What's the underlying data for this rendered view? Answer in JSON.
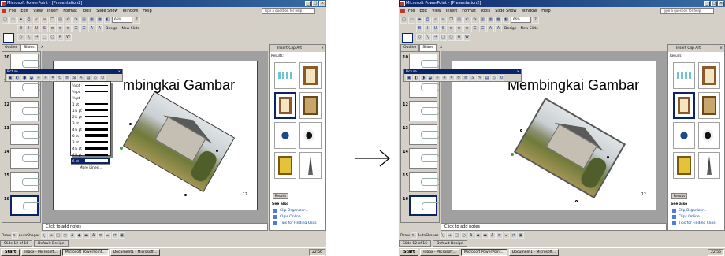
{
  "app": {
    "title": "Microsoft PowerPoint - [Presentation2]",
    "menus": [
      "File",
      "Edit",
      "View",
      "Insert",
      "Format",
      "Tools",
      "Slide Show",
      "Window",
      "Help"
    ],
    "help_placeholder": "Type a question for help",
    "zoom": "66%",
    "toolbar_design": "Design",
    "toolbar_new_slide": "New Slide"
  },
  "pane_tabs": {
    "outline": "Outline",
    "slides": "Slides"
  },
  "slide": {
    "title_left": "mbingkai Gambar",
    "title_right": "Membingkai Gambar",
    "page_number": "12"
  },
  "thumb_numbers": [
    "10",
    "11",
    "12",
    "13",
    "14",
    "15",
    "16"
  ],
  "picture_toolbar": {
    "title": "Picture"
  },
  "line_style_menu": {
    "items": [
      "¼ pt",
      "½ pt",
      "¾ pt",
      "1 pt",
      "1½ pt",
      "2¼ pt",
      "3 pt",
      "4½ pt",
      "6 pt",
      "3 pt",
      "4½ pt",
      "4½ pt",
      "6 pt"
    ],
    "weights": [
      0.5,
      0.8,
      1,
      1.3,
      1.6,
      2,
      2.5,
      3,
      3.5,
      2.5,
      3,
      3,
      3.5
    ],
    "highlighted_index": 12,
    "more": "More Lines..."
  },
  "notes": {
    "placeholder": "Click to add notes"
  },
  "task_pane": {
    "title": "Insert Clip Art",
    "results_label": "Results:",
    "search_button": "Results",
    "see_also": "See also",
    "links": [
      "Clip Organizer...",
      "Clips Online",
      "Tips for Finding Clips"
    ]
  },
  "draw_toolbar": {
    "draw_label": "Draw",
    "autoshapes_label": "AutoShapes"
  },
  "status": {
    "slide_of": "Slide 12 of 16",
    "design": "Default Design"
  },
  "taskbar": {
    "start": "Start",
    "items": [
      "Inbox - Microsoft...",
      "Microsoft PowerPoint...",
      "Document1 - Microsoft..."
    ],
    "clock": "22:56"
  },
  "colors": {
    "titlebar": "#0a246a",
    "face": "#d4d0c8",
    "highlight": "#0a246a"
  }
}
